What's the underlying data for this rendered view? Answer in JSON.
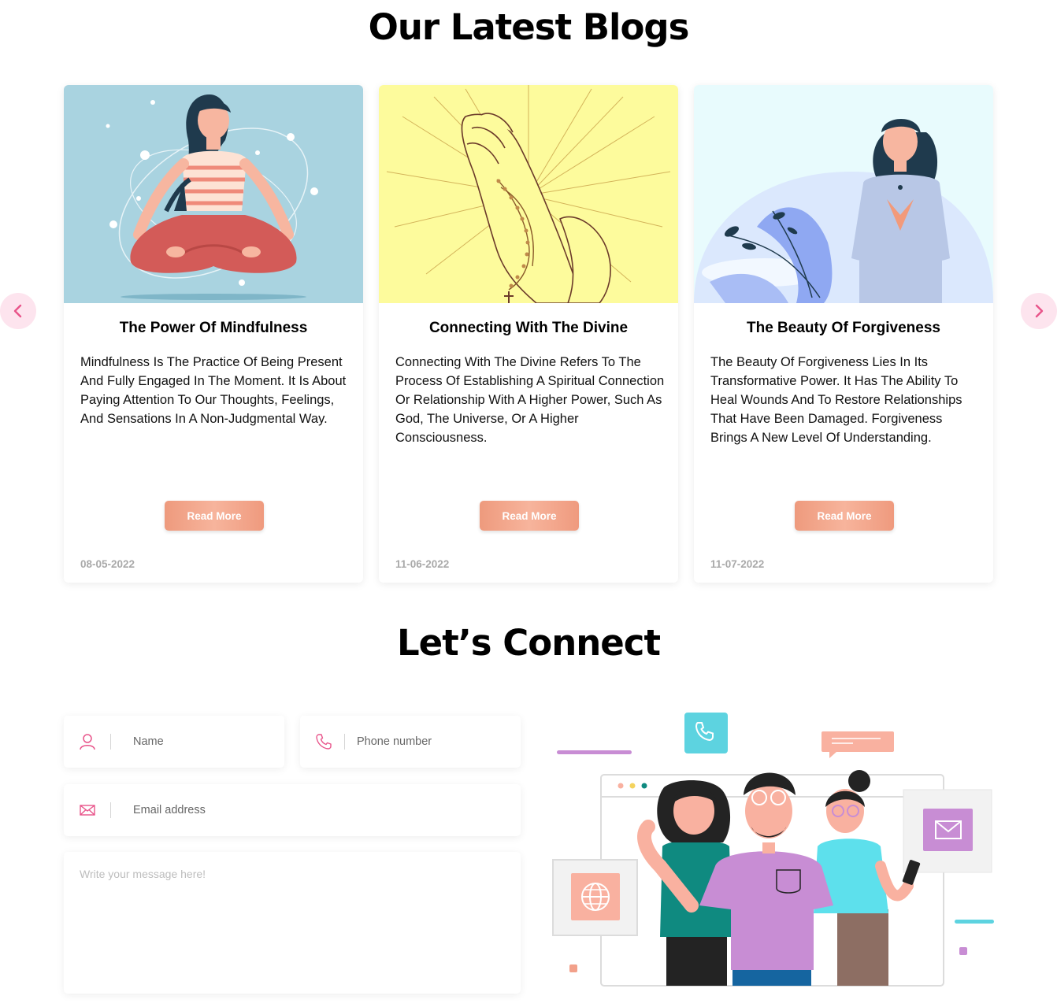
{
  "blogs": {
    "title": "Our Latest Blogs",
    "cards": [
      {
        "title": "The Power Of Mindfulness",
        "description": "Mindfulness Is The Practice Of Being Present And Fully Engaged In The Moment. It Is About Paying Attention To Our Thoughts, Feelings, And Sensations In A Non-Judgmental Way.",
        "button": "Read More",
        "date": "08-05-2022",
        "image_bg": "#a9d3e0"
      },
      {
        "title": "Connecting With The Divine",
        "description": "Connecting With The Divine Refers To The Process Of Establishing A Spiritual Connection Or Relationship With A Higher Power, Such As God, The Universe, Or A Higher Consciousness.",
        "button": "Read More",
        "date": "11-06-2022",
        "image_bg": "#fdfb9c"
      },
      {
        "title": "The Beauty Of Forgiveness",
        "description": "The Beauty Of Forgiveness Lies In Its Transformative Power. It Has The Ability To Heal Wounds And To Restore Relationships That Have Been Damaged. Forgiveness Brings A New Level Of Understanding.",
        "button": "Read More",
        "date": "11-07-2022",
        "image_bg": "#e8fbfd"
      }
    ],
    "arrow_left_icon": "chevron-left-icon",
    "arrow_right_icon": "chevron-right-icon"
  },
  "connect": {
    "title": "Let’s Connect",
    "name_placeholder": "Name",
    "phone_placeholder": "Phone number",
    "email_placeholder": "Email address",
    "message_placeholder": "Write your message here!"
  },
  "colors": {
    "accent_pink": "#e8548a",
    "button_gradient_start": "#ee9a7d",
    "arrow_bg": "#fde4ee"
  }
}
